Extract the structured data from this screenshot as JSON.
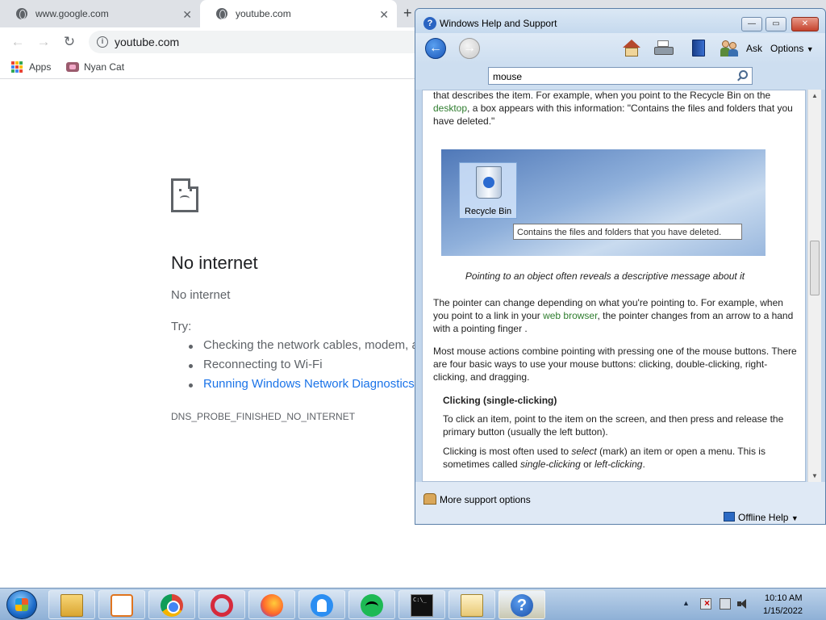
{
  "browser": {
    "tabs": [
      {
        "title": "www.google.com",
        "active": false
      },
      {
        "title": "youtube.com",
        "active": true
      }
    ],
    "url": "youtube.com",
    "bookmarks": [
      {
        "label": "Apps",
        "icon": "apps-grid-icon"
      },
      {
        "label": "Nyan Cat",
        "icon": "nyan-cat-icon"
      }
    ],
    "error": {
      "title": "No internet",
      "subtitle": "No internet",
      "try_label": "Try:",
      "suggestions": [
        "Checking the network cables, modem, and router",
        "Reconnecting to Wi-Fi",
        "Running Windows Network Diagnostics"
      ],
      "code": "DNS_PROBE_FINISHED_NO_INTERNET"
    }
  },
  "help_window": {
    "title": "Windows Help and Support",
    "toolbar": {
      "ask_label": "Ask",
      "options_label": "Options"
    },
    "search_value": "mouse",
    "content": {
      "para1_a": "that describes the item. For example, when you point to the Recycle Bin on the",
      "para1_link": "desktop",
      "para1_b": ", a box appears with this information: \"Contains the files and folders that you have deleted.\"",
      "recycle_bin_label": "Recycle Bin",
      "tooltip": "Contains the files and folders that you have deleted.",
      "caption": "Pointing to an object often reveals a descriptive message about it",
      "para2_a": "The pointer can change depending on what you're pointing to. For example, when you point to a link in your ",
      "para2_link": "web browser",
      "para2_b": ", the pointer changes from an arrow to a hand with a pointing finger .",
      "para3": "Most mouse actions combine pointing with pressing one of the mouse buttons. There are four basic ways to use your mouse buttons: clicking, double-clicking, right-clicking, and dragging.",
      "heading": "Clicking (single-clicking)",
      "para4": "To click an item, point to the item on the screen, and then press and release the primary button (usually the left button).",
      "para5_a": "Clicking is most often used to ",
      "para5_select": "select",
      "para5_b": " (mark) an item or open a menu. This is sometimes called ",
      "para5_single": "single-clicking",
      "para5_c": " or ",
      "para5_left": "left-clicking",
      "para5_d": "."
    },
    "footer": {
      "support_label": "More support options",
      "offline_label": "Offline Help"
    }
  },
  "taskbar": {
    "apps": [
      {
        "name": "windows-explorer"
      },
      {
        "name": "media-player"
      },
      {
        "name": "google-chrome"
      },
      {
        "name": "opera"
      },
      {
        "name": "firefox"
      },
      {
        "name": "ghost-app"
      },
      {
        "name": "spotify"
      },
      {
        "name": "command-prompt",
        "glyph": "C:\\_"
      },
      {
        "name": "calculator"
      },
      {
        "name": "help-and-support",
        "glyph": "?"
      }
    ],
    "clock": {
      "time": "10:10 AM",
      "date": "1/15/2022"
    }
  },
  "colors": {
    "link_blue": "#1a73e8",
    "help_link_green": "#2f7d2f",
    "taskbar_blue": "#8eb0d6"
  }
}
